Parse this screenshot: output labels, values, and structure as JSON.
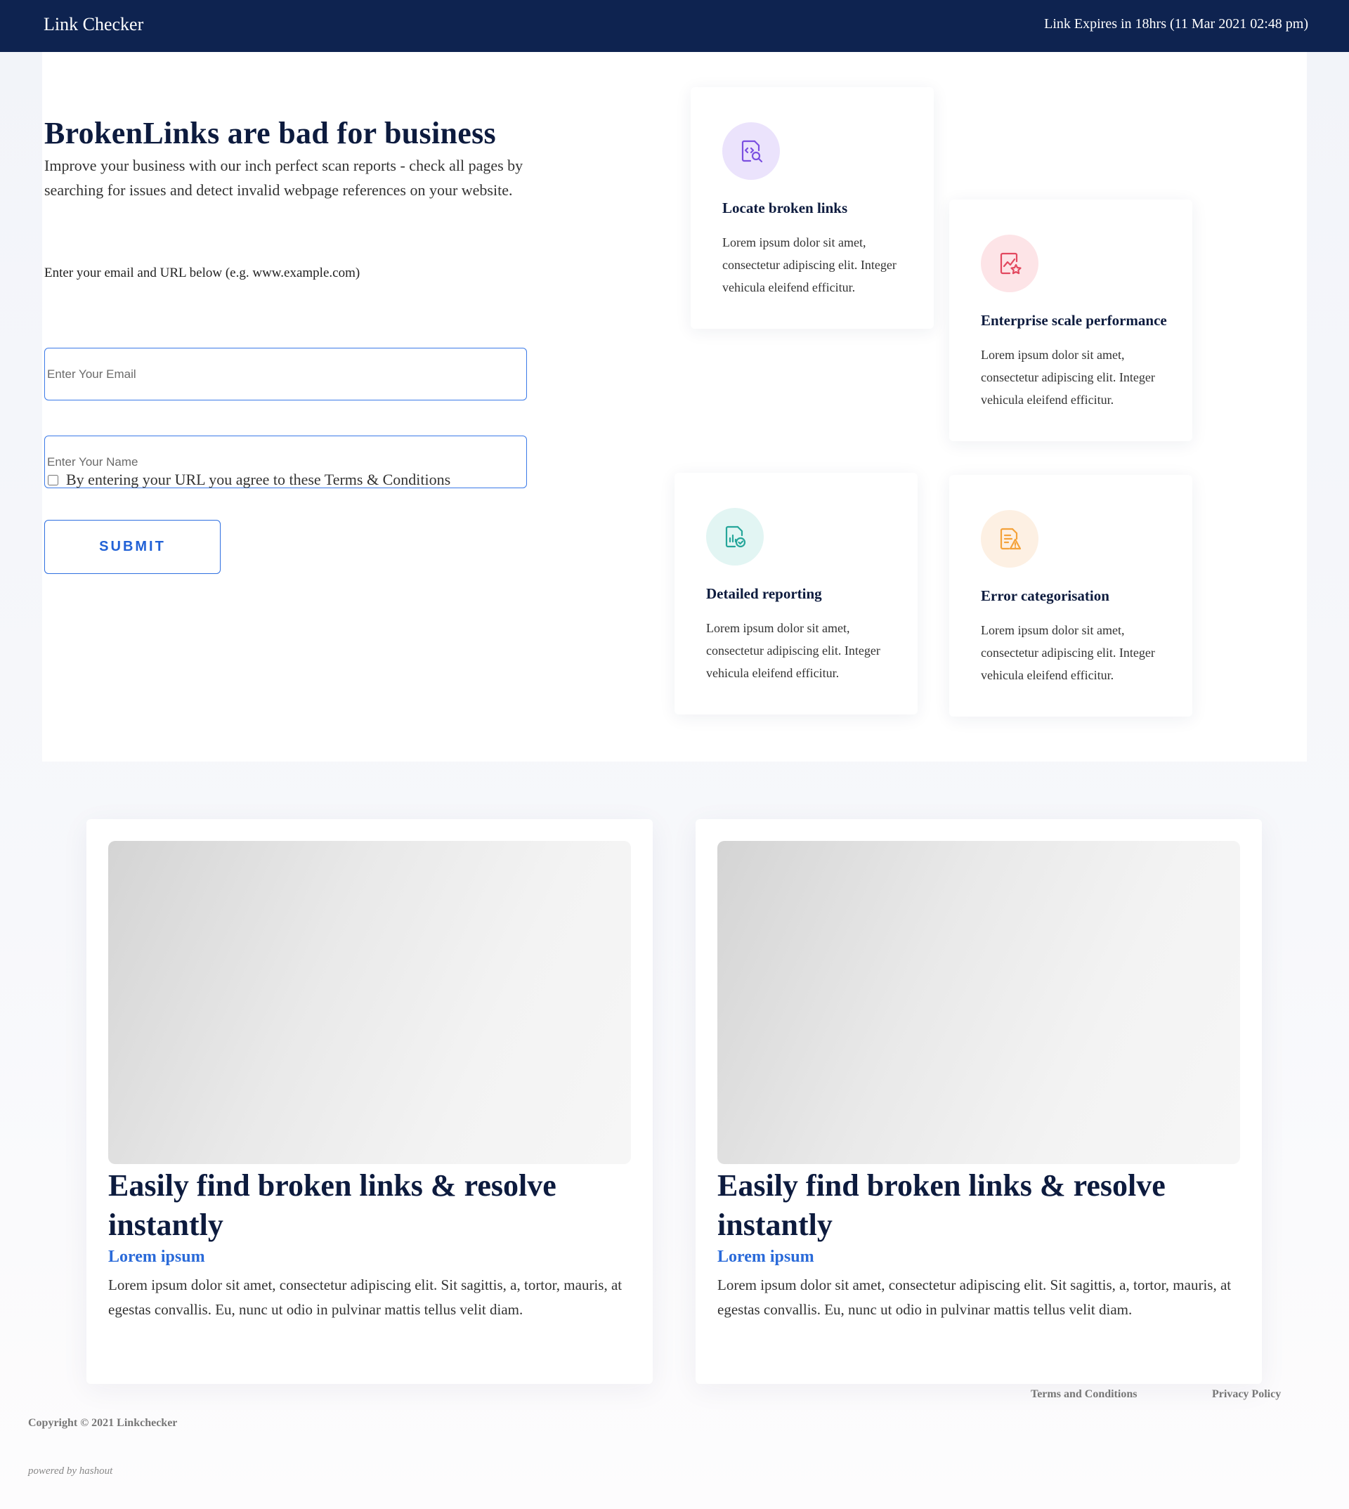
{
  "header": {
    "brand": "Link Checker",
    "expiry": "Link Expires in 18hrs (11 Mar 2021 02:48 pm)"
  },
  "hero": {
    "title": "BrokenLinks are bad for business",
    "subtitle": "Improve your business with our inch perfect scan reports - check all pages by searching for issues and detect invalid webpage references on your website."
  },
  "form": {
    "label": "Enter your email and URL below (e.g. www.example.com)",
    "email_placeholder": "Enter Your Email",
    "name_placeholder": "Enter Your Name",
    "terms_text": "By entering your URL you agree to these Terms & Conditions",
    "terms_checked": false,
    "submit_label": "SUBMIT"
  },
  "features": [
    {
      "title": "Locate broken links",
      "description": "Lorem ipsum dolor sit amet, consectetur adipiscing elit. Integer vehicula eleifend efficitur.",
      "icon": "document-search-icon",
      "icon_color": "#7b4fe0",
      "icon_bg": "#ebe3fc"
    },
    {
      "title": "Enterprise scale performance",
      "description": "Lorem ipsum dolor sit amet, consectetur adipiscing elit. Integer vehicula eleifend efficitur.",
      "icon": "chart-star-icon",
      "icon_color": "#e2485f",
      "icon_bg": "#fde4e7"
    },
    {
      "title": "Detailed reporting",
      "description": "Lorem ipsum dolor sit amet, consectetur adipiscing elit. Integer vehicula eleifend efficitur.",
      "icon": "report-check-icon",
      "icon_color": "#26a69a",
      "icon_bg": "#e2f5f3"
    },
    {
      "title": "Error categorisation",
      "description": "Lorem ipsum dolor sit amet, consectetur adipiscing elit. Integer vehicula eleifend efficitur.",
      "icon": "document-warning-icon",
      "icon_color": "#f4a23a",
      "icon_bg": "#fdf0e3"
    }
  ],
  "cards": [
    {
      "title": "Easily find broken links & resolve instantly",
      "subtitle": "Lorem ipsum",
      "text": "Lorem ipsum dolor sit amet, consectetur adipiscing elit. Sit sagittis, a, tortor, mauris, at egestas convallis. Eu, nunc ut odio in pulvinar mattis tellus velit diam."
    },
    {
      "title": "Easily find broken links & resolve instantly",
      "subtitle": "Lorem ipsum",
      "text": "Lorem ipsum dolor sit amet, consectetur adipiscing elit. Sit sagittis, a, tortor, mauris, at egestas convallis. Eu, nunc ut odio in pulvinar mattis tellus velit diam."
    }
  ],
  "footer": {
    "terms_link": "Terms and Conditions",
    "privacy_link": "Privacy Policy",
    "copyright": "Copyright © 2021 Linkchecker",
    "powered_by": "powered by hashout"
  },
  "colors": {
    "header_bg": "#0e2350",
    "accent": "#2a6ad9",
    "heading": "#0d1b3e"
  }
}
